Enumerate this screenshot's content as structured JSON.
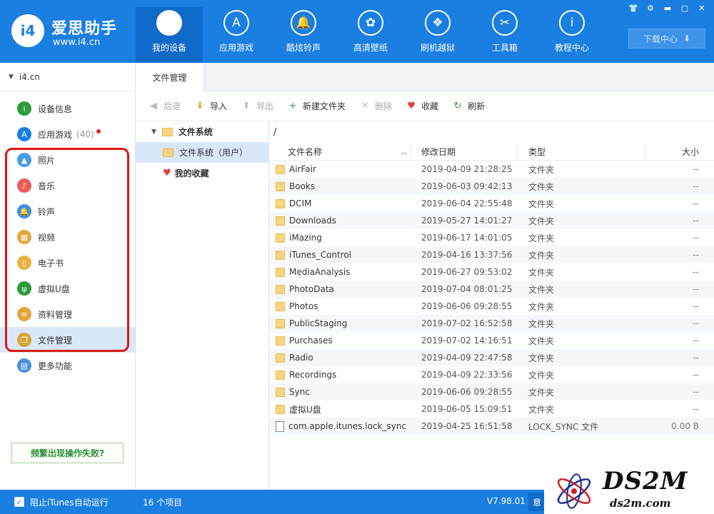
{
  "header": {
    "logo_mark": "i4",
    "logo_title": "爱思助手",
    "logo_url": "www.i4.cn",
    "nav": [
      {
        "label": "我的设备",
        "icon": "apple-icon",
        "glyph": "",
        "active": true
      },
      {
        "label": "应用游戏",
        "icon": "app-store-icon",
        "glyph": "A",
        "active": false
      },
      {
        "label": "酷炫铃声",
        "icon": "bell-icon",
        "glyph": "🔔",
        "active": false
      },
      {
        "label": "高清壁纸",
        "icon": "flower-icon",
        "glyph": "✿",
        "active": false
      },
      {
        "label": "刷机越狱",
        "icon": "dropbox-icon",
        "glyph": "❖",
        "active": false
      },
      {
        "label": "工具箱",
        "icon": "tools-icon",
        "glyph": "✂",
        "active": false
      },
      {
        "label": "教程中心",
        "icon": "info-icon",
        "glyph": "i",
        "active": false
      }
    ],
    "window_controls": [
      "👕",
      "⚙",
      "▬",
      "▢",
      "✕"
    ],
    "download_label": "下载中心",
    "download_glyph": "⬇"
  },
  "sidebar": {
    "device_name": "i4.cn",
    "items": [
      {
        "label": "设备信息",
        "icon": "info-circle-icon",
        "glyph": "i",
        "color": "#2e9a3b",
        "count": "",
        "dot": false,
        "active": false
      },
      {
        "label": "应用游戏",
        "icon": "app-store-icon",
        "glyph": "A",
        "color": "#1a7fe0",
        "count": "(40)",
        "dot": true,
        "active": false
      },
      {
        "label": "照片",
        "icon": "photo-icon",
        "glyph": "▲",
        "color": "#4a9be6",
        "count": "",
        "dot": false,
        "active": false
      },
      {
        "label": "音乐",
        "icon": "music-icon",
        "glyph": "♪",
        "color": "#ec5a5a",
        "count": "",
        "dot": false,
        "active": false
      },
      {
        "label": "铃声",
        "icon": "bell-icon",
        "glyph": "🔔",
        "color": "#3b8fe3",
        "count": "",
        "dot": false,
        "active": false
      },
      {
        "label": "视频",
        "icon": "video-icon",
        "glyph": "▦",
        "color": "#e3a53a",
        "count": "",
        "dot": false,
        "active": false
      },
      {
        "label": "电子书",
        "icon": "book-icon",
        "glyph": "▯",
        "color": "#e8b23d",
        "count": "",
        "dot": false,
        "active": false
      },
      {
        "label": "虚拟U盘",
        "icon": "usb-icon",
        "glyph": "ψ",
        "color": "#2e9a3b",
        "count": "",
        "dot": false,
        "active": false
      },
      {
        "label": "资料管理",
        "icon": "contacts-icon",
        "glyph": "≡",
        "color": "#e3a53a",
        "count": "",
        "dot": false,
        "active": false
      },
      {
        "label": "文件管理",
        "icon": "files-icon",
        "glyph": "❐",
        "color": "#d9a437",
        "count": "",
        "dot": false,
        "active": true
      },
      {
        "label": "更多功能",
        "icon": "grid-icon",
        "glyph": "▤",
        "color": "#4a8fd8",
        "count": "",
        "dot": false,
        "active": false
      }
    ],
    "trouble_label": "频繁出现操作失败?"
  },
  "main": {
    "tab_label": "文件管理",
    "toolbar": [
      {
        "label": "后退",
        "icon": "back-icon",
        "glyph": "◀",
        "color": "#bbb",
        "disabled": true
      },
      {
        "label": "导入",
        "icon": "import-icon",
        "glyph": "⬇",
        "color": "#e3a53a",
        "disabled": false
      },
      {
        "label": "导出",
        "icon": "export-icon",
        "glyph": "⬆",
        "color": "#bbb",
        "disabled": true
      },
      {
        "label": "新建文件夹",
        "icon": "new-folder-icon",
        "glyph": "+",
        "color": "#2e9a3b",
        "disabled": false
      },
      {
        "label": "删除",
        "icon": "delete-icon",
        "glyph": "✕",
        "color": "#bbb",
        "disabled": true
      },
      {
        "label": "收藏",
        "icon": "heart-icon",
        "glyph": "♥",
        "color": "#e0403a",
        "disabled": false
      },
      {
        "label": "刷新",
        "icon": "refresh-icon",
        "glyph": "↻",
        "color": "#2e9a3b",
        "disabled": false
      }
    ],
    "tree": {
      "root": "文件系统",
      "child": "文件系统（用户）",
      "favorites": "我的收藏"
    },
    "path": "/",
    "columns": {
      "name": "文件名称",
      "date": "修改日期",
      "type": "类型",
      "size": "大小"
    },
    "files": [
      {
        "name": "AirFair",
        "date": "2019-04-09 21:28:25",
        "type": "文件夹",
        "size": "--",
        "folder": true
      },
      {
        "name": "Books",
        "date": "2019-06-03 09:42:13",
        "type": "文件夹",
        "size": "--",
        "folder": true
      },
      {
        "name": "DCIM",
        "date": "2019-06-04 22:55:48",
        "type": "文件夹",
        "size": "--",
        "folder": true
      },
      {
        "name": "Downloads",
        "date": "2019-05-27 14:01:27",
        "type": "文件夹",
        "size": "--",
        "folder": true
      },
      {
        "name": "iMazing",
        "date": "2019-06-17 14:01:05",
        "type": "文件夹",
        "size": "--",
        "folder": true
      },
      {
        "name": "iTunes_Control",
        "date": "2019-04-16 13:37:56",
        "type": "文件夹",
        "size": "--",
        "folder": true
      },
      {
        "name": "MediaAnalysis",
        "date": "2019-06-27 09:53:02",
        "type": "文件夹",
        "size": "--",
        "folder": true
      },
      {
        "name": "PhotoData",
        "date": "2019-07-04 08:01:25",
        "type": "文件夹",
        "size": "--",
        "folder": true
      },
      {
        "name": "Photos",
        "date": "2019-06-06 09:28:55",
        "type": "文件夹",
        "size": "--",
        "folder": true
      },
      {
        "name": "PublicStaging",
        "date": "2019-07-02 16:52:58",
        "type": "文件夹",
        "size": "--",
        "folder": true
      },
      {
        "name": "Purchases",
        "date": "2019-07-02 14:16:51",
        "type": "文件夹",
        "size": "--",
        "folder": true
      },
      {
        "name": "Radio",
        "date": "2019-04-09 22:47:58",
        "type": "文件夹",
        "size": "--",
        "folder": true
      },
      {
        "name": "Recordings",
        "date": "2019-04-09 22:33:56",
        "type": "文件夹",
        "size": "--",
        "folder": true
      },
      {
        "name": "Sync",
        "date": "2019-06-06 09:28:55",
        "type": "文件夹",
        "size": "--",
        "folder": true
      },
      {
        "name": "虚拟U盘",
        "date": "2019-06-05 15:09:51",
        "type": "文件夹",
        "size": "--",
        "folder": true
      },
      {
        "name": "com.apple.itunes.lock_sync",
        "date": "2019-04-25 16:51:58",
        "type": "LOCK_SYNC 文件",
        "size": "0.00 B",
        "folder": false
      }
    ]
  },
  "status": {
    "checkbox_label": "阻止iTunes自动运行",
    "count": "16 个项目",
    "version": "V7.98.01",
    "extra": "意"
  },
  "watermark": {
    "big": "DS2M",
    "small": "ds2m.com"
  }
}
